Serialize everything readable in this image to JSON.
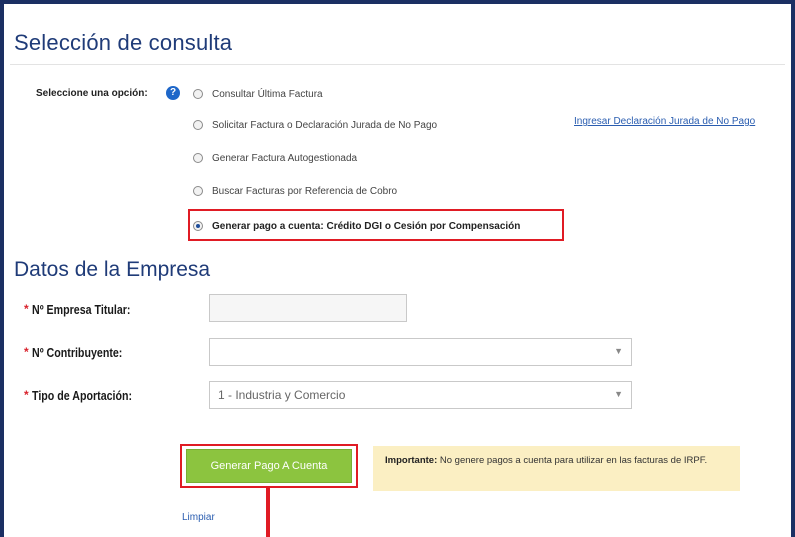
{
  "section1": {
    "title": "Selección de consulta",
    "prompt": "Seleccione una opción:",
    "options": [
      {
        "label": "Consultar Última Factura",
        "selected": false
      },
      {
        "label": "Solicitar Factura o Declaración Jurada de No Pago",
        "selected": false
      },
      {
        "label": "Generar Factura Autogestionada",
        "selected": false
      },
      {
        "label": "Buscar Facturas por Referencia de Cobro",
        "selected": false
      },
      {
        "label": "Generar pago a cuenta: Crédito DGI o Cesión por Compensación",
        "selected": true
      }
    ],
    "link": "Ingresar Declaración Jurada de No Pago"
  },
  "section2": {
    "title": "Datos de la Empresa",
    "fields": {
      "empresa_label": "Nº Empresa Titular:",
      "empresa_value": "",
      "contribuyente_label": "Nº Contribuyente:",
      "contribuyente_value": "",
      "aportacion_label": "Tipo de Aportación:",
      "aportacion_value": "1 - Industria y Comercio"
    },
    "required_mark": "*"
  },
  "actions": {
    "generate_label": "Generar Pago A Cuenta",
    "clear_label": "Limpiar"
  },
  "note": {
    "strong": "Importante:",
    "text": " No genere pagos a cuenta para utilizar en las facturas de IRPF."
  },
  "colors": {
    "frame": "#1b2f63",
    "heading": "#1f3b78",
    "highlight": "#e01b24",
    "button": "#8cc43f",
    "note_bg": "#fbefc3"
  },
  "icons": {
    "help": "question-circle-icon",
    "dropdown": "chevron-down-icon"
  }
}
